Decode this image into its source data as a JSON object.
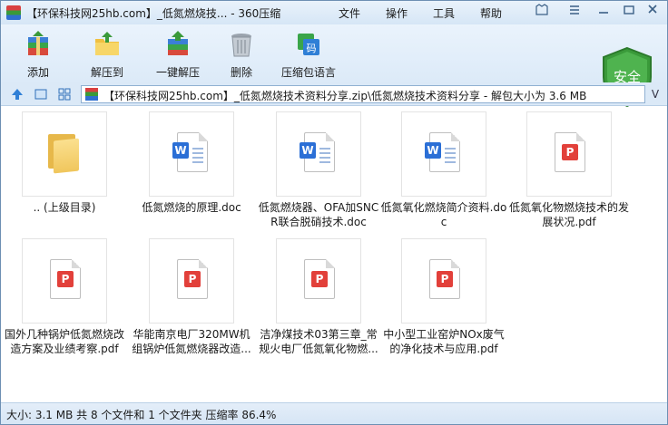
{
  "window": {
    "title": "【环保科技网25hb.com】_低氮燃烧技... - 360压缩",
    "menu": [
      "文件",
      "操作",
      "工具",
      "帮助"
    ]
  },
  "toolbar": {
    "items": [
      {
        "label": "添加",
        "icon": "add-archive-icon"
      },
      {
        "label": "解压到",
        "icon": "extract-to-icon"
      },
      {
        "label": "一键解压",
        "icon": "one-click-extract-icon"
      },
      {
        "label": "删除",
        "icon": "delete-trash-icon"
      },
      {
        "label": "压缩包语言",
        "icon": "archive-language-icon"
      }
    ],
    "shield_label": "安全"
  },
  "address": {
    "path": "【环保科技网25hb.com】_低氮燃烧技术资料分享.zip\\低氮燃烧技术资料分享 - 解包大小为 3.6 MB",
    "dropdown": "V"
  },
  "files": [
    {
      "name": ".. (上级目录)",
      "type": "folder"
    },
    {
      "name": "低氮燃烧的原理.doc",
      "type": "doc"
    },
    {
      "name": "低氮燃烧器、OFA加SNCR联合脱硝技术.doc",
      "type": "doc"
    },
    {
      "name": "低氮氧化燃烧简介资料.doc",
      "type": "doc"
    },
    {
      "name": "低氮氧化物燃烧技术的发展状况.pdf",
      "type": "pdf"
    },
    {
      "name": "国外几种锅炉低氮燃烧改造方案及业绩考察.pdf",
      "type": "pdf"
    },
    {
      "name": "华能南京电厂320MW机组锅炉低氮燃烧器改造...",
      "type": "pdf"
    },
    {
      "name": "洁净煤技术03第三章_常规火电厂低氮氧化物燃...",
      "type": "pdf"
    },
    {
      "name": "中小型工业窑炉NOx废气的净化技术与应用.pdf",
      "type": "pdf"
    }
  ],
  "status": {
    "text": "大小: 3.1 MB 共 8 个文件和 1 个文件夹 压缩率 86.4%"
  },
  "colors": {
    "doc_badge": "#2b6fd6",
    "pdf_badge": "#e2403a",
    "shield": "#3a9a3a"
  }
}
